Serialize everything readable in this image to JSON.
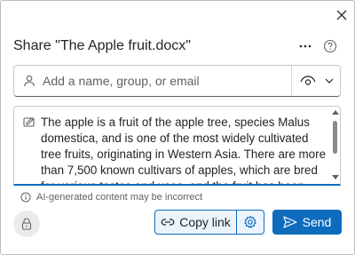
{
  "header": {
    "title": "Share \"The Apple fruit.docx\"",
    "close_icon": "close-icon",
    "more_icon": "more-options-icon",
    "help_icon": "help-icon"
  },
  "recipients": {
    "placeholder": "Add a name, group, or email",
    "value": "",
    "person_icon": "person-icon",
    "permission_icon": "eye-icon",
    "dropdown_icon": "chevron-down-icon"
  },
  "message": {
    "text": "The apple is a fruit of the apple tree, species Malus domestica, and is one of the most widely cultivated tree fruits, originating in Western Asia. There are more than 7,500 known cultivars of apples, which are bred for various tastes and uses, and the fruit has been present in the mythology and religions of many cultures.",
    "edit_icon": "edit-message-icon"
  },
  "ai_note": {
    "text": "AI-generated content may be incorrect",
    "icon": "info-icon"
  },
  "footer": {
    "lock_icon": "lock-icon",
    "copy_link_label": "Copy link",
    "copy_link_icon": "link-icon",
    "settings_icon": "gear-icon",
    "send_label": "Send",
    "send_icon": "send-icon"
  },
  "colors": {
    "accent": "#0f6cbd",
    "accent_light": "#ebf3fc",
    "text": "#242424",
    "muted": "#616161"
  }
}
